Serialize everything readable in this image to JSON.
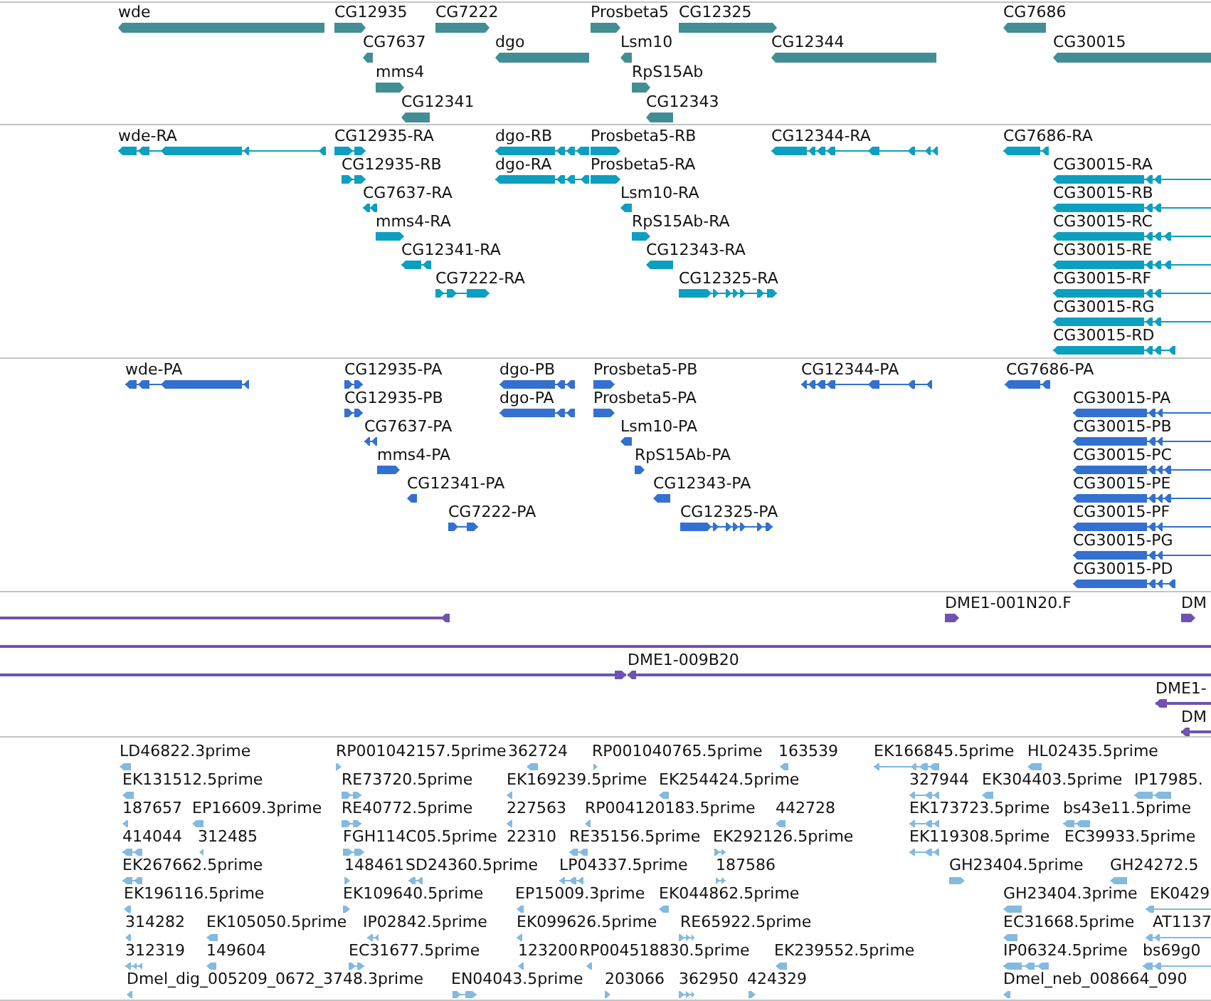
{
  "tracks": [
    {
      "kind": "gene",
      "color": "#438e94",
      "features": [
        {
          "label": "wde",
          "reverse": true
        },
        {
          "label": "CG12935",
          "reverse": false
        },
        {
          "label": "CG7222",
          "reverse": false
        },
        {
          "label": "Prosbeta5",
          "reverse": false
        },
        {
          "label": "CG12325",
          "reverse": false
        },
        {
          "label": "CG7686",
          "reverse": true
        },
        {
          "label": "CG7637",
          "reverse": true
        },
        {
          "label": "dgo",
          "reverse": true
        },
        {
          "label": "Lsm10",
          "reverse": true
        },
        {
          "label": "CG12344",
          "reverse": true
        },
        {
          "label": "CG30015",
          "reverse": true
        },
        {
          "label": "mms4",
          "reverse": false
        },
        {
          "label": "RpS15Ab",
          "reverse": false
        },
        {
          "label": "CG12341",
          "reverse": true
        },
        {
          "label": "CG12343",
          "reverse": true
        }
      ]
    },
    {
      "kind": "transcript",
      "color": "#0c9fc0",
      "features": [
        {
          "label": "wde-RA",
          "reverse": true
        },
        {
          "label": "CG12935-RA",
          "reverse": false
        },
        {
          "label": "dgo-RB",
          "reverse": true
        },
        {
          "label": "Prosbeta5-RB",
          "reverse": false
        },
        {
          "label": "CG12344-RA",
          "reverse": true
        },
        {
          "label": "CG7686-RA",
          "reverse": true
        },
        {
          "label": "CG12935-RB",
          "reverse": false
        },
        {
          "label": "dgo-RA",
          "reverse": true
        },
        {
          "label": "Prosbeta5-RA",
          "reverse": false
        },
        {
          "label": "CG30015-RA",
          "reverse": true
        },
        {
          "label": "CG7637-RA",
          "reverse": true
        },
        {
          "label": "Lsm10-RA",
          "reverse": true
        },
        {
          "label": "CG30015-RB",
          "reverse": true
        },
        {
          "label": "mms4-RA",
          "reverse": false
        },
        {
          "label": "RpS15Ab-RA",
          "reverse": false
        },
        {
          "label": "CG30015-RC",
          "reverse": true
        },
        {
          "label": "CG12341-RA",
          "reverse": true
        },
        {
          "label": "CG12343-RA",
          "reverse": true
        },
        {
          "label": "CG30015-RE",
          "reverse": true
        },
        {
          "label": "CG7222-RA",
          "reverse": false
        },
        {
          "label": "CG12325-RA",
          "reverse": false
        },
        {
          "label": "CG30015-RF",
          "reverse": true
        },
        {
          "label": "CG30015-RG",
          "reverse": true
        },
        {
          "label": "CG30015-RD",
          "reverse": true
        }
      ]
    },
    {
      "kind": "protein",
      "color": "#3370d0",
      "features": [
        {
          "label": "wde-PA",
          "reverse": true
        },
        {
          "label": "CG12935-PA",
          "reverse": false
        },
        {
          "label": "dgo-PB",
          "reverse": true
        },
        {
          "label": "Prosbeta5-PB",
          "reverse": false
        },
        {
          "label": "CG12344-PA",
          "reverse": true
        },
        {
          "label": "CG7686-PA",
          "reverse": true
        },
        {
          "label": "CG12935-PB",
          "reverse": false
        },
        {
          "label": "dgo-PA",
          "reverse": true
        },
        {
          "label": "Prosbeta5-PA",
          "reverse": false
        },
        {
          "label": "CG30015-PA",
          "reverse": true
        },
        {
          "label": "CG7637-PA",
          "reverse": true
        },
        {
          "label": "Lsm10-PA",
          "reverse": true
        },
        {
          "label": "CG30015-PB",
          "reverse": true
        },
        {
          "label": "mms4-PA",
          "reverse": false
        },
        {
          "label": "RpS15Ab-PA",
          "reverse": false
        },
        {
          "label": "CG30015-PC",
          "reverse": true
        },
        {
          "label": "CG12341-PA",
          "reverse": true
        },
        {
          "label": "CG12343-PA",
          "reverse": true
        },
        {
          "label": "CG30015-PE",
          "reverse": true
        },
        {
          "label": "CG7222-PA",
          "reverse": false
        },
        {
          "label": "CG12325-PA",
          "reverse": false
        },
        {
          "label": "CG30015-PF",
          "reverse": true
        },
        {
          "label": "CG30015-PG",
          "reverse": true
        },
        {
          "label": "CG30015-PD",
          "reverse": true
        }
      ]
    },
    {
      "kind": "clone",
      "color": "#7052b0",
      "features": [
        {
          "kind": "line",
          "reverse": true
        },
        {
          "kind": "end",
          "label": "DME1-001N20.F",
          "reverse": false
        },
        {
          "kind": "end",
          "label": "DM",
          "reverse": false
        },
        {
          "kind": "line"
        },
        {
          "kind": "line",
          "reverse": false
        },
        {
          "kind": "line",
          "label": "DME1-009B20",
          "reverse": true
        },
        {
          "kind": "line",
          "label": "DME1-",
          "reverse": true
        },
        {
          "kind": "line",
          "label": "DM",
          "reverse": true
        }
      ]
    },
    {
      "kind": "est",
      "color": "#84b9e0",
      "features": [
        {
          "label": "LD46822.3prime",
          "reverse": true
        },
        {
          "label": "RP001042157.5prime",
          "reverse": false
        },
        {
          "label": "362724",
          "reverse": true
        },
        {
          "label": "RP001040765.5prime",
          "reverse": false
        },
        {
          "label": "163539",
          "reverse": true
        },
        {
          "label": "EK166845.5prime",
          "reverse": true
        },
        {
          "label": "HL02435.5prime",
          "reverse": true
        },
        {
          "label": "EK131512.5prime",
          "reverse": true
        },
        {
          "label": "RE73720.5prime",
          "reverse": false
        },
        {
          "label": "EK169239.5prime",
          "reverse": true
        },
        {
          "label": "EK254424.5prime",
          "reverse": true
        },
        {
          "label": "327944",
          "reverse": true
        },
        {
          "label": "EK304403.5prime",
          "reverse": true
        },
        {
          "label": "IP17985.",
          "reverse": true
        },
        {
          "label": "187657",
          "reverse": true
        },
        {
          "label": "EP16609.3prime",
          "reverse": true
        },
        {
          "label": "RE40772.5prime",
          "reverse": false
        },
        {
          "label": "227563",
          "reverse": true
        },
        {
          "label": "RP004120183.5prime",
          "reverse": true
        },
        {
          "label": "442728",
          "reverse": true
        },
        {
          "label": "EK173723.5prime",
          "reverse": true
        },
        {
          "label": "bs43e11.5prime",
          "reverse": true
        },
        {
          "label": "414044",
          "reverse": true
        },
        {
          "label": "312485",
          "reverse": true
        },
        {
          "label": "FGH114C05.5prime",
          "reverse": false
        },
        {
          "label": "22310"
        },
        {
          "label": "RE35156.5prime",
          "reverse": true
        },
        {
          "label": "EK292126.5prime",
          "reverse": false
        },
        {
          "label": "EK119308.5prime",
          "reverse": true
        },
        {
          "label": "EC39933.5prime"
        },
        {
          "label": "EK267662.5prime",
          "reverse": true
        },
        {
          "label": "148461",
          "reverse": false
        },
        {
          "label": "SD24360.5prime",
          "reverse": true
        },
        {
          "label": "LP04337.5prime",
          "reverse": true
        },
        {
          "label": "187586",
          "reverse": false
        },
        {
          "label": "GH23404.5prime",
          "reverse": false
        },
        {
          "label": "GH24272.5",
          "reverse": true
        },
        {
          "label": "EK196116.5prime",
          "reverse": true
        },
        {
          "label": "EK109640.5prime",
          "reverse": false
        },
        {
          "label": "EP15009.3prime",
          "reverse": true
        },
        {
          "label": "EK044862.5prime",
          "reverse": true
        },
        {
          "label": "GH23404.3prime",
          "reverse": true
        },
        {
          "label": "EK0429",
          "reverse": true
        },
        {
          "label": "314282",
          "reverse": true
        },
        {
          "label": "EK105050.5prime",
          "reverse": true
        },
        {
          "label": "IP02842.5prime",
          "reverse": true
        },
        {
          "label": "EK099626.5prime",
          "reverse": true
        },
        {
          "label": "RE65922.5prime",
          "reverse": false
        },
        {
          "label": "EC31668.5prime",
          "reverse": true
        },
        {
          "label": "AT1137",
          "reverse": true
        },
        {
          "label": "312319",
          "reverse": true
        },
        {
          "label": "149604",
          "reverse": true
        },
        {
          "label": "EC31677.5prime",
          "reverse": false
        },
        {
          "label": "123200",
          "reverse": true
        },
        {
          "label": "RP004518830.5prime",
          "reverse": true
        },
        {
          "label": "EK239552.5prime",
          "reverse": true
        },
        {
          "label": "IP06324.5prime",
          "reverse": true
        },
        {
          "label": "bs69g0",
          "reverse": true
        },
        {
          "label": "Dmel_dig_005209_0672_3748.3prime",
          "reverse": true
        },
        {
          "label": "EN04043.5prime",
          "reverse": false
        },
        {
          "label": "203066",
          "reverse": false
        },
        {
          "label": "362950",
          "reverse": false
        },
        {
          "label": "424329",
          "reverse": false
        },
        {
          "label": "Dmel_neb_008664_090",
          "reverse": true
        }
      ]
    }
  ]
}
